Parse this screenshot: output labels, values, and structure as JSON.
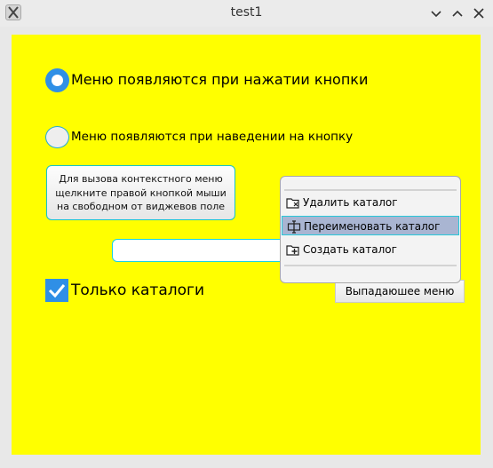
{
  "window": {
    "title": "test1"
  },
  "radio_options": [
    {
      "label": "Меню появляются при нажатии кнопки",
      "selected": true
    },
    {
      "label": "Меню появляются при наведении на кнопку",
      "selected": false
    }
  ],
  "hint_lines": [
    "Для вызова контекстного меню",
    "щелкните правой кнопкой мыши",
    "на свободном от виджевов поле"
  ],
  "input": {
    "value": ""
  },
  "checkbox": {
    "label": "Только каталоги",
    "checked": true
  },
  "dropdown_button": {
    "label": "Выпадаюшее меню"
  },
  "context_menu": {
    "items": [
      {
        "label": "Удалить каталог",
        "icon": "folder-delete-icon"
      },
      {
        "label": "Переименовать каталог",
        "icon": "folder-rename-icon",
        "active": true
      },
      {
        "label": "Создать каталог",
        "icon": "folder-add-icon"
      }
    ]
  },
  "colors": {
    "background": "#ffff00",
    "accent": "#2f8fe6",
    "focus": "#19d2e4",
    "highlight": "#a9b5d2"
  }
}
